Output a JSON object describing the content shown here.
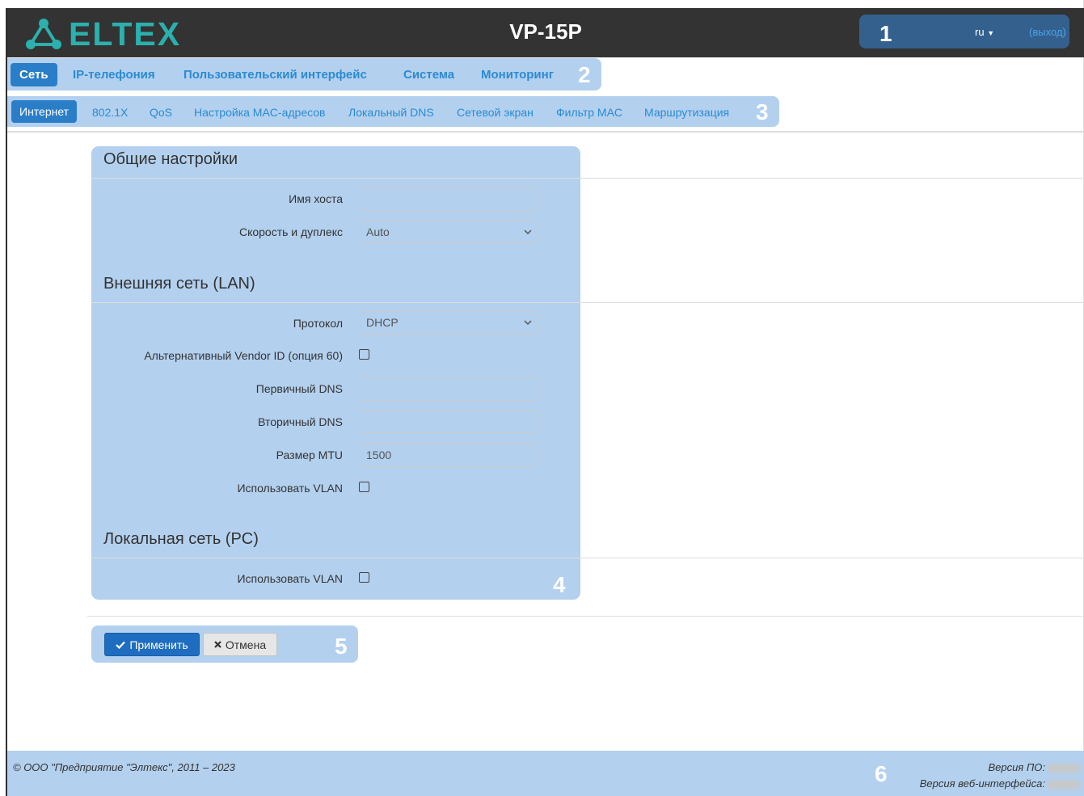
{
  "header": {
    "brand": "ELTEX",
    "device": "VP-15P",
    "lang": "ru",
    "logout": "(выход)"
  },
  "callouts": [
    "1",
    "2",
    "3",
    "4",
    "5",
    "6"
  ],
  "nav": {
    "items": [
      {
        "label": "Сеть",
        "active": true
      },
      {
        "label": "IP-телефония"
      },
      {
        "label": "Пользовательский интерфейс"
      },
      {
        "label": "Система"
      },
      {
        "label": "Мониторинг"
      }
    ]
  },
  "subnav": {
    "items": [
      {
        "label": "Интернет",
        "active": true
      },
      {
        "label": "802.1X"
      },
      {
        "label": "QoS"
      },
      {
        "label": "Настройка MAC-адресов"
      },
      {
        "label": "Локальный DNS"
      },
      {
        "label": "Сетевой экран"
      },
      {
        "label": "Фильтр MAC"
      },
      {
        "label": "Маршрутизация"
      }
    ]
  },
  "form": {
    "general": {
      "title": "Общие настройки",
      "hostname_label": "Имя хоста",
      "hostname_value": "",
      "speed_label": "Скорость и дуплекс",
      "speed_value": "Auto"
    },
    "wan": {
      "title": "Внешняя сеть (LAN)",
      "protocol_label": "Протокол",
      "protocol_value": "DHCP",
      "vendor_label": "Альтернативный Vendor ID (опция 60)",
      "vendor_checked": false,
      "dns1_label": "Первичный DNS",
      "dns1_value": "",
      "dns2_label": "Вторичный DNS",
      "dns2_value": "",
      "mtu_label": "Размер MTU",
      "mtu_value": "1500",
      "vlan_label": "Использовать VLAN",
      "vlan_checked": false
    },
    "lan": {
      "title": "Локальная сеть (PC)",
      "vlan_label": "Использовать VLAN",
      "vlan_checked": false
    }
  },
  "buttons": {
    "apply": "Применить",
    "cancel": "Отмена"
  },
  "footer": {
    "copyright": "© ООО \"Предприятие \"Элтекс\", 2011 – 2023",
    "fw_label": "Версия ПО:",
    "web_label": "Версия веб-интерфейса:"
  },
  "colors": {
    "header_bg": "#333333",
    "brand": "#2bb0ad",
    "accent": "#2a7ec8",
    "highlight": "#b3d0ee"
  }
}
